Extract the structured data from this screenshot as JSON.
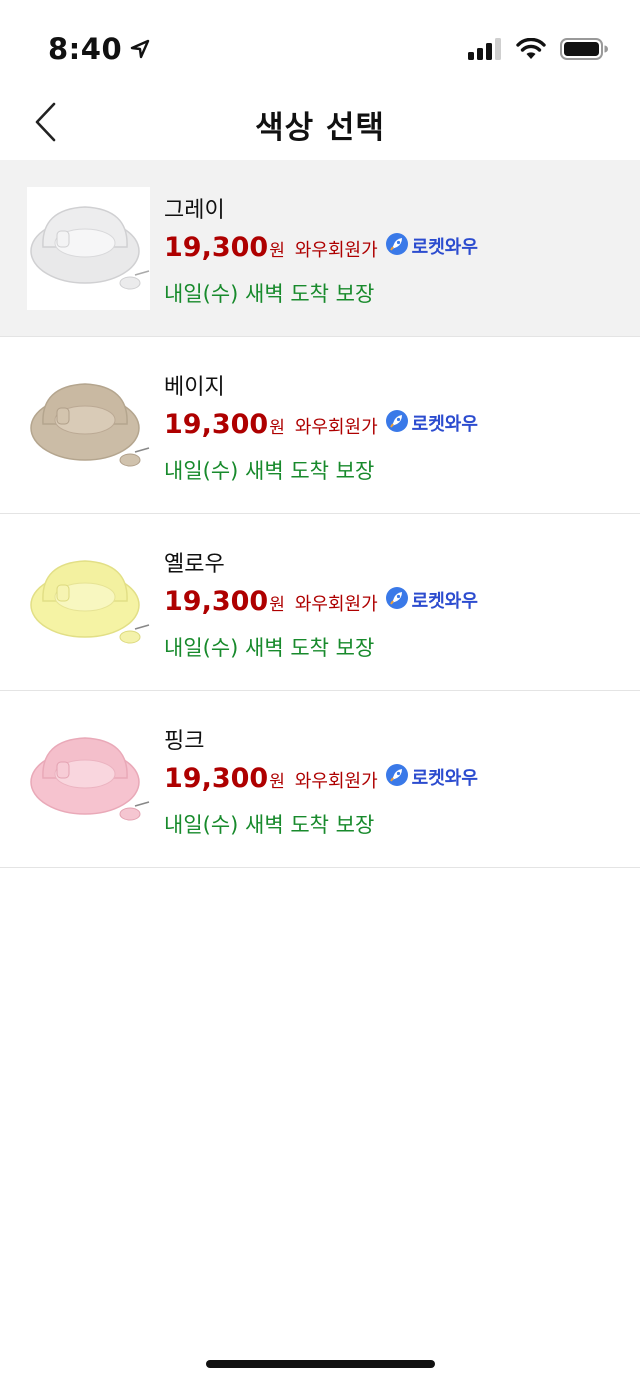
{
  "status_bar": {
    "time": "8:40"
  },
  "nav": {
    "title": "색상 선택"
  },
  "items": [
    {
      "name": "그레이",
      "price": "19,300",
      "currency": "원",
      "member_label": "와우회원가",
      "rocket_label": "로켓와우",
      "delivery": "내일(수) 새벽 도착 보장",
      "selected": true,
      "color": "#e9e9ea"
    },
    {
      "name": "베이지",
      "price": "19,300",
      "currency": "원",
      "member_label": "와우회원가",
      "rocket_label": "로켓와우",
      "delivery": "내일(수) 새벽 도착 보장",
      "selected": false,
      "color": "#cbbca6"
    },
    {
      "name": "옐로우",
      "price": "19,300",
      "currency": "원",
      "member_label": "와우회원가",
      "rocket_label": "로켓와우",
      "delivery": "내일(수) 새벽 도착 보장",
      "selected": false,
      "color": "#f5f3a4"
    },
    {
      "name": "핑크",
      "price": "19,300",
      "currency": "원",
      "member_label": "와우회원가",
      "rocket_label": "로켓와우",
      "delivery": "내일(수) 새벽 도착 보장",
      "selected": false,
      "color": "#f6c3cf"
    }
  ],
  "colors": {
    "price": "#ae0000",
    "rocket": "#2c4ccf",
    "delivery": "#188a2c",
    "selected_bg": "#f2f2f2"
  }
}
